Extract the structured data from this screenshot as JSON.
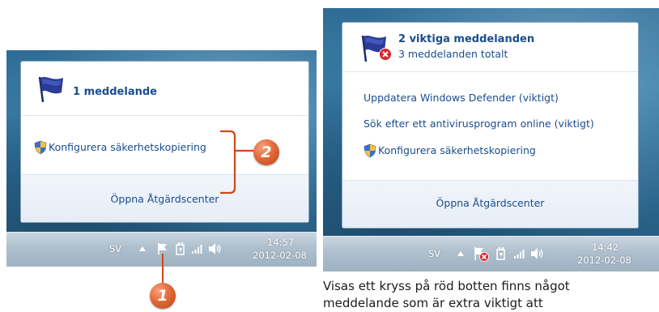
{
  "left_popup": {
    "title": "1 meddelande",
    "item": "Konfigurera säkerhetskopiering",
    "footer": "Öppna Åtgärdscenter"
  },
  "right_popup": {
    "title": "2 viktiga meddelanden",
    "subtitle": "3 meddelanden totalt",
    "items": [
      "Uppdatera Windows Defender (viktigt)",
      "Sök efter ett antivirusprogram online (viktigt)",
      "Konfigurera säkerhetskopiering"
    ],
    "footer": "Öppna Åtgärdscenter"
  },
  "left_taskbar": {
    "lang": "SV",
    "time": "14:57",
    "date": "2012-02-08"
  },
  "right_taskbar": {
    "lang": "SV",
    "time": "14:42",
    "date": "2012-02-08"
  },
  "callouts": {
    "one": "1",
    "two": "2"
  },
  "caption": [
    "Visas ett kryss på röd botten finns något",
    "meddelande som är extra viktigt att"
  ],
  "colors": {
    "link": "#1a4d8f",
    "badge": "#e26a3a"
  }
}
